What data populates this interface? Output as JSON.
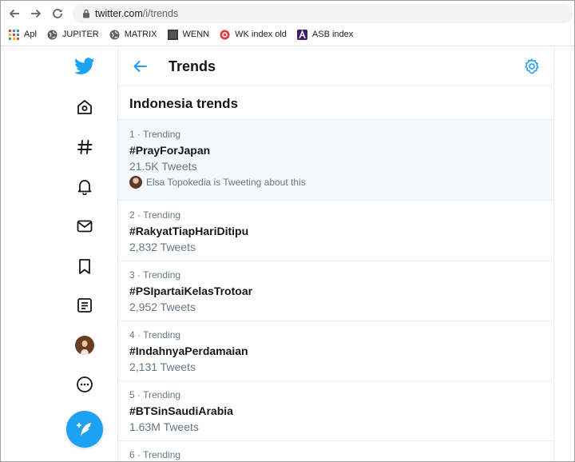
{
  "browser": {
    "url_host": "twitter.com",
    "url_path": "/i/trends",
    "bookmarks": [
      {
        "label": "Apl",
        "icon": "apps-grid-icon"
      },
      {
        "label": "JUPITER",
        "icon": "globe-icon"
      },
      {
        "label": "MATRIX",
        "icon": "globe-icon"
      },
      {
        "label": "WENN",
        "icon": "square-icon"
      },
      {
        "label": "WK index old",
        "icon": "target-icon"
      },
      {
        "label": "ASB index",
        "icon": "asb-icon"
      }
    ]
  },
  "header": {
    "title": "Trends"
  },
  "section": {
    "title": "Indonesia trends"
  },
  "trends": [
    {
      "meta": "1 · Trending",
      "name": "#PrayForJapan",
      "count": "21.5K Tweets",
      "context": "Elsa Topokedia is Tweeting about this"
    },
    {
      "meta": "2 · Trending",
      "name": "#RakyatTiapHariDitipu",
      "count": "2,832 Tweets"
    },
    {
      "meta": "3 · Trending",
      "name": "#PSIpartaiKelasTrotoar",
      "count": "2,952 Tweets"
    },
    {
      "meta": "4 · Trending",
      "name": "#IndahnyaPerdamaian",
      "count": "2,131 Tweets"
    },
    {
      "meta": "5 · Trending",
      "name": "#BTSinSaudiArabia",
      "count": "1.63M Tweets"
    },
    {
      "meta": "6 · Trending"
    }
  ],
  "colors": {
    "accent": "#1da1f2",
    "text": "#14171a",
    "secondary": "#657786"
  }
}
